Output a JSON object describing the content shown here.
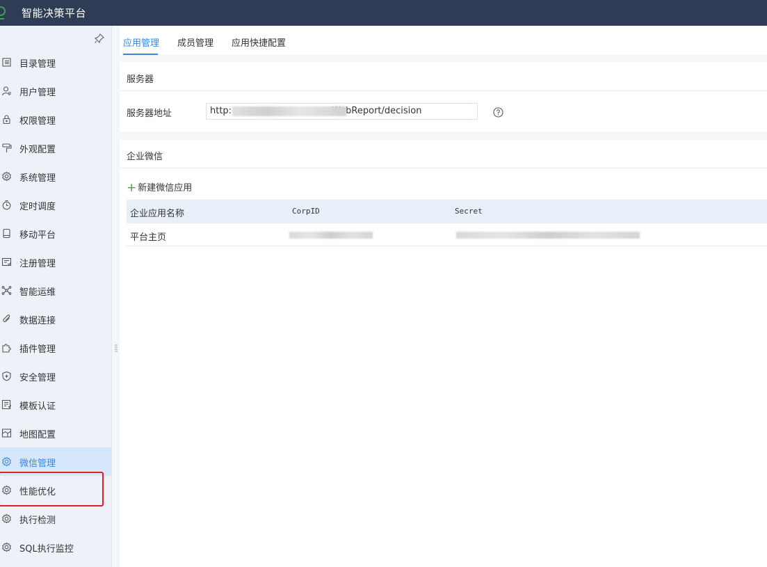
{
  "header": {
    "title": "智能决策平台"
  },
  "sidebar": {
    "items": [
      {
        "label": "目录管理",
        "icon": "list-icon"
      },
      {
        "label": "用户管理",
        "icon": "user-icon"
      },
      {
        "label": "权限管理",
        "icon": "lock-icon"
      },
      {
        "label": "外观配置",
        "icon": "paint-roller-icon"
      },
      {
        "label": "系统管理",
        "icon": "gear-icon"
      },
      {
        "label": "定时调度",
        "icon": "timer-icon"
      },
      {
        "label": "移动平台",
        "icon": "mobile-icon"
      },
      {
        "label": "注册管理",
        "icon": "register-icon"
      },
      {
        "label": "智能运维",
        "icon": "network-icon"
      },
      {
        "label": "数据连接",
        "icon": "paperclip-icon"
      },
      {
        "label": "插件管理",
        "icon": "puzzle-icon"
      },
      {
        "label": "安全管理",
        "icon": "shield-icon"
      },
      {
        "label": "模板认证",
        "icon": "template-icon"
      },
      {
        "label": "地图配置",
        "icon": "map-icon"
      },
      {
        "label": "微信管理",
        "icon": "gear-icon",
        "active": true
      },
      {
        "label": "性能优化",
        "icon": "gear-icon"
      },
      {
        "label": "执行检测",
        "icon": "gear-icon"
      },
      {
        "label": "SQL执行监控",
        "icon": "gear-icon"
      }
    ]
  },
  "tabs": [
    {
      "label": "应用管理",
      "active": true
    },
    {
      "label": "成员管理"
    },
    {
      "label": "应用快捷配置"
    }
  ],
  "server": {
    "section_title": "服务器",
    "address_label": "服务器地址",
    "address_prefix": "http:",
    "address_suffix": "WebReport/decision"
  },
  "wechat": {
    "section_title": "企业微信",
    "add_label": "新建微信应用",
    "columns": [
      "企业应用名称",
      "CorpID",
      "Secret"
    ],
    "rows": [
      {
        "name": "平台主页"
      }
    ]
  },
  "colors": {
    "accent": "#3b87e0",
    "topbar": "#2e3d55",
    "add": "#3ea04a",
    "highlight": "#e02020"
  }
}
